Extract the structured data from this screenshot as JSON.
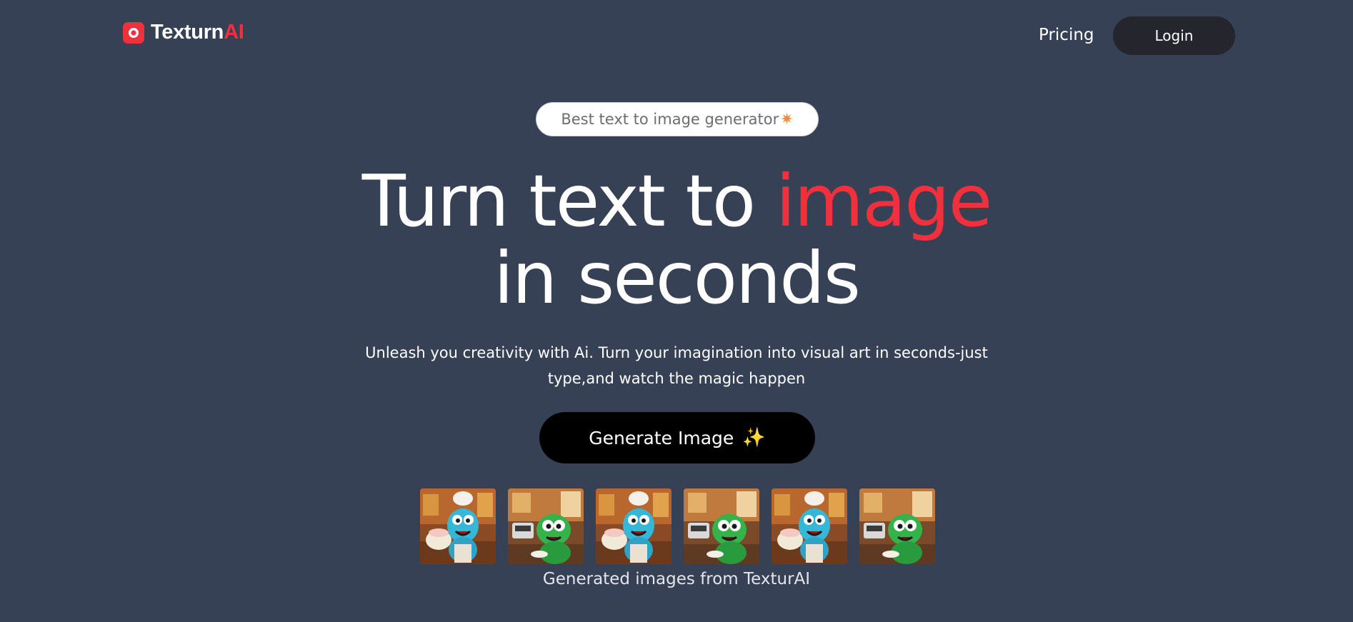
{
  "header": {
    "brand_main": "Texturn",
    "brand_accent": "AI",
    "nav_pricing": "Pricing",
    "login_label": "Login"
  },
  "hero": {
    "badge_text": "Best text to image generator",
    "badge_icon": "star-icon",
    "headline_part1": "Turn text to ",
    "headline_highlight": "image",
    "headline_part2": "in seconds",
    "subtitle_line1": "Unleash you creativity with Ai. Turn your imagination into visual art in seconds-just",
    "subtitle_line2": "type,and watch the magic happen",
    "cta_label": "Generate Image",
    "cta_icon": "sparkles-icon"
  },
  "gallery": {
    "thumbnails": [
      "blue-monster-chef",
      "green-monster-chef",
      "blue-monster-chef",
      "green-monster-chef",
      "blue-monster-chef",
      "green-monster-chef"
    ],
    "caption": "Generated images from TexturAI"
  },
  "colors": {
    "background": "#374155",
    "accent": "#f0303d",
    "login_bg": "#25262d",
    "cta_bg": "#000000"
  }
}
